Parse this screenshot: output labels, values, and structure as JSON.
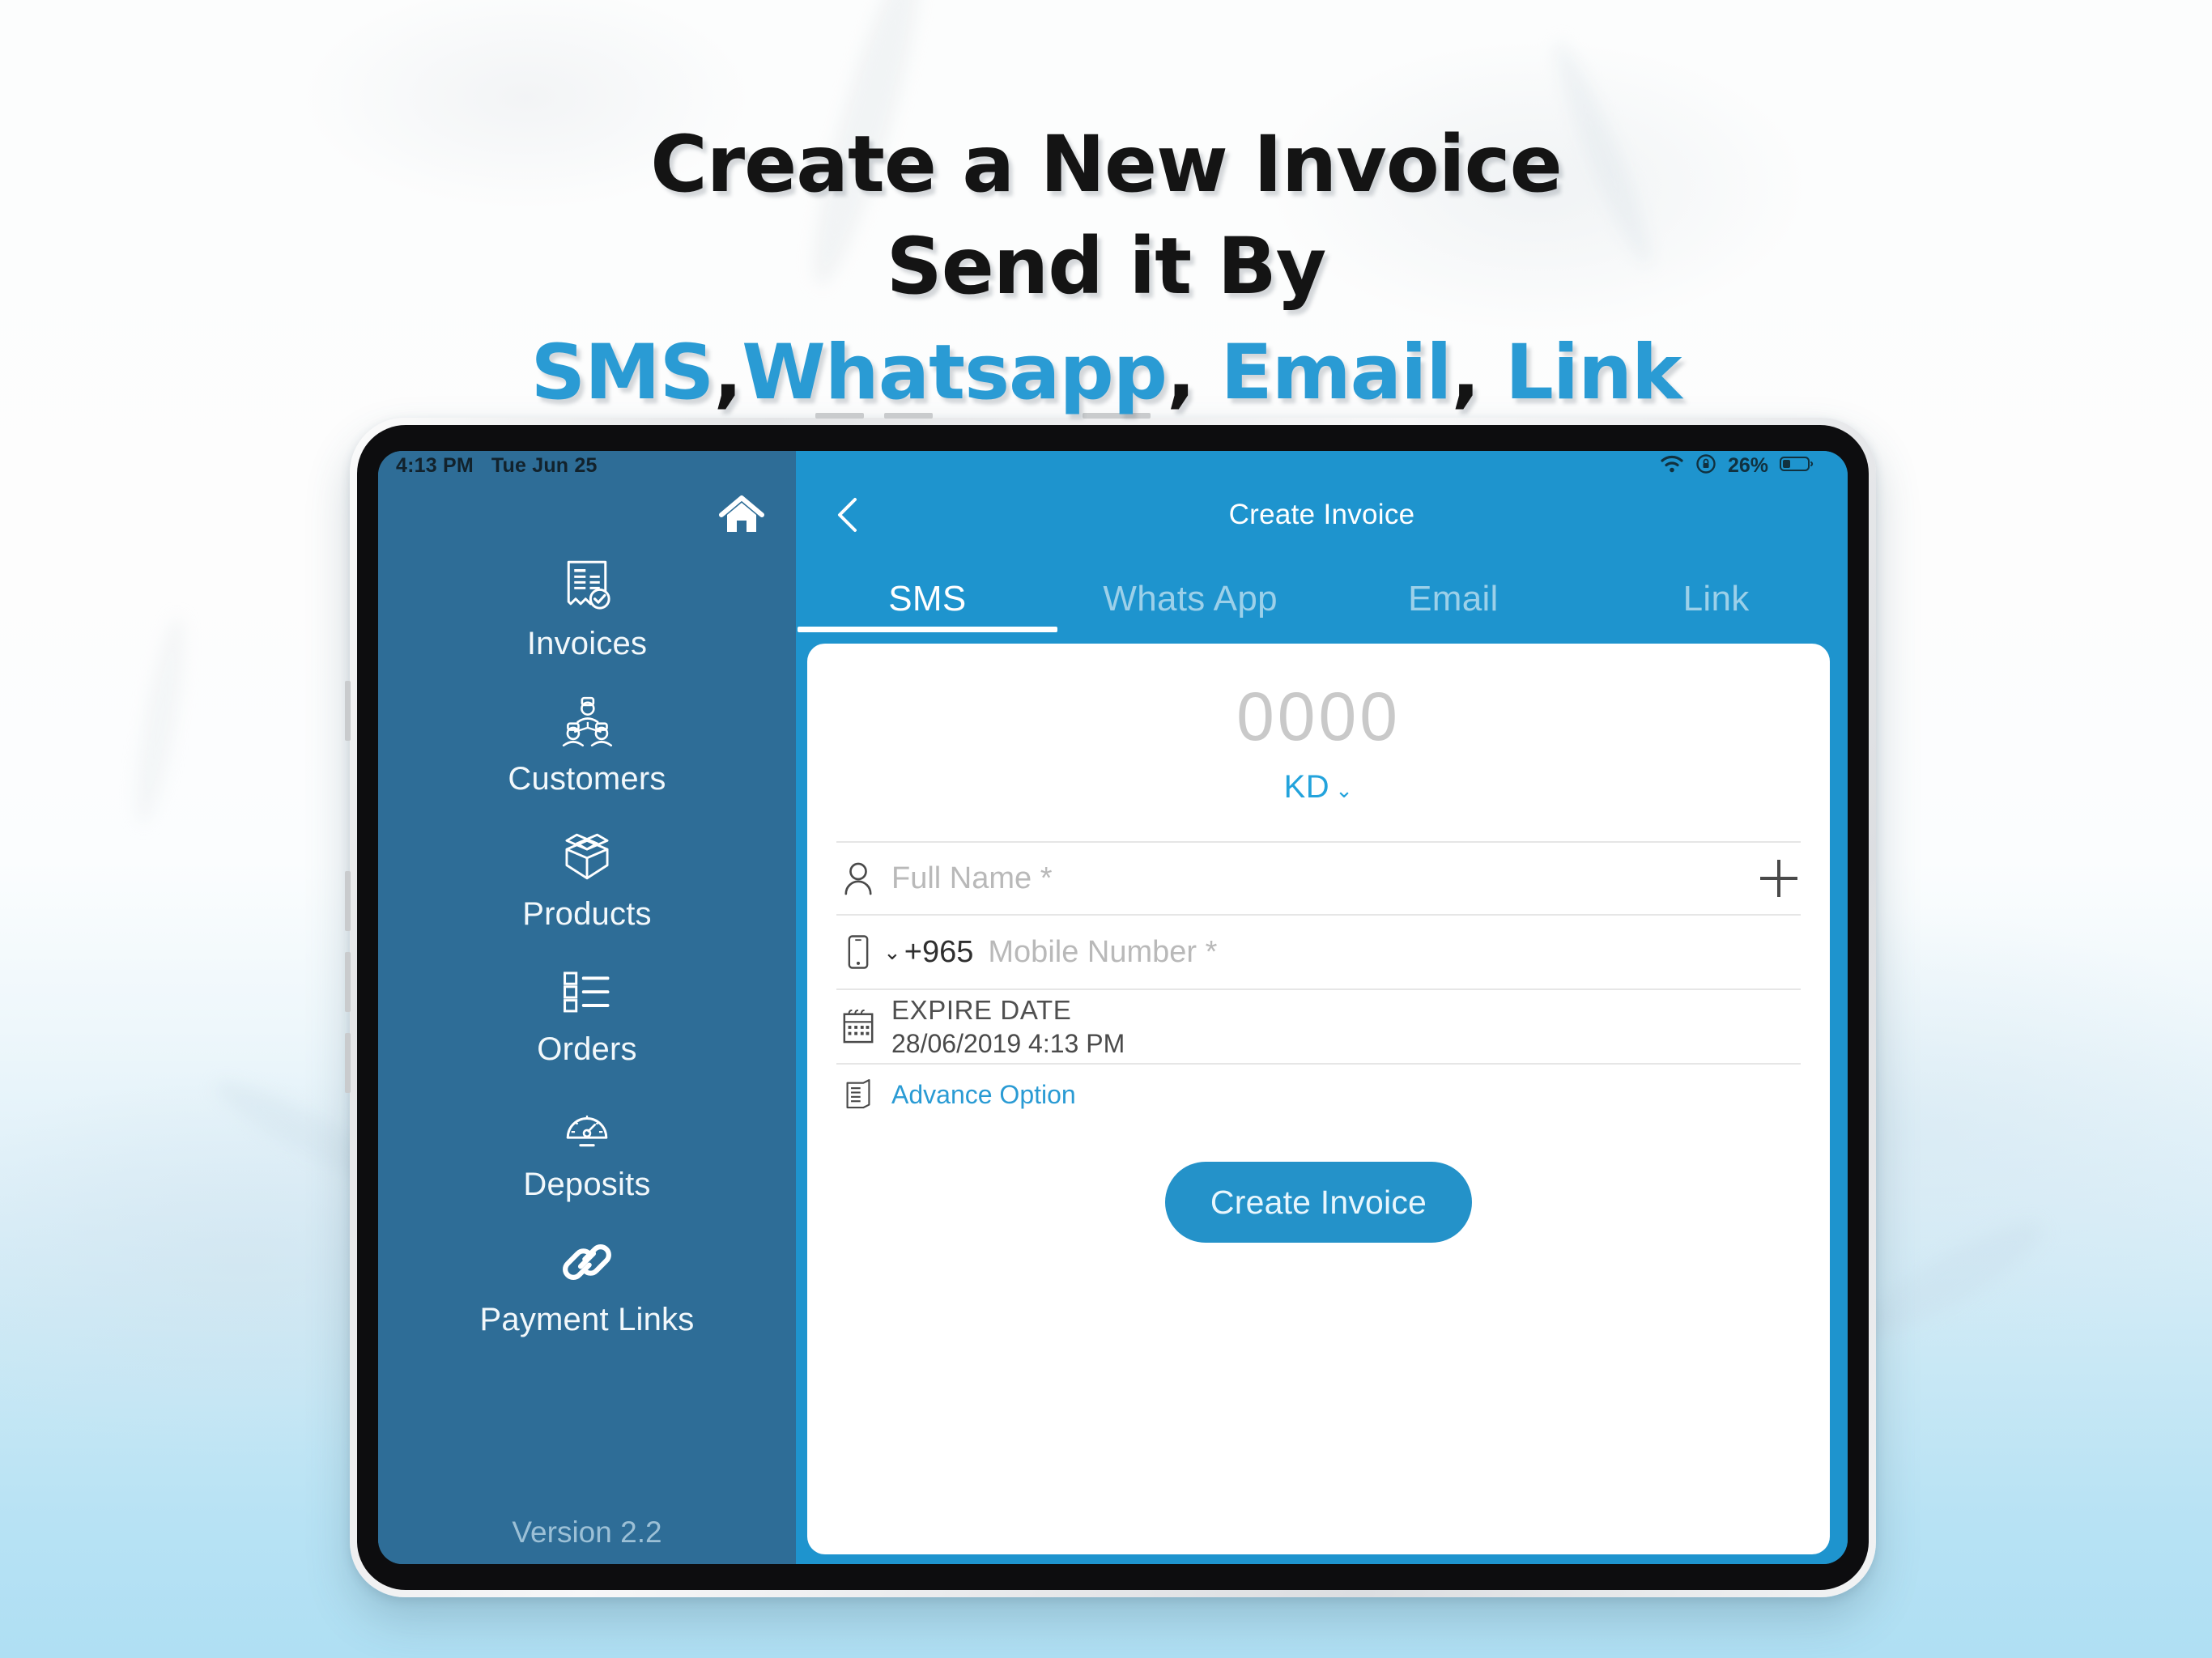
{
  "promo": {
    "line1": "Create a New Invoice",
    "line2": "Send it By",
    "channels": [
      "SMS",
      "Whatsapp",
      "Email",
      "Link"
    ],
    "separator": ",",
    "accent_color": "#2A9BD4",
    "text_color": "#141414"
  },
  "status_bar": {
    "time": "4:13 PM",
    "date": "Tue Jun 25",
    "battery_percent": "26%",
    "wifi_icon": "wifi-icon",
    "rotation_lock_icon": "rotation-lock-icon",
    "battery_icon": "battery-icon"
  },
  "sidebar": {
    "background_color": "#2E6D97",
    "home_icon": "home-icon",
    "items": [
      {
        "label": "Invoices",
        "icon": "invoice-document-icon"
      },
      {
        "label": "Customers",
        "icon": "people-group-icon"
      },
      {
        "label": "Products",
        "icon": "open-box-icon"
      },
      {
        "label": "Orders",
        "icon": "checklist-icon"
      },
      {
        "label": "Deposits",
        "icon": "gauge-icon"
      },
      {
        "label": "Payment Links",
        "icon": "chain-link-icon"
      }
    ],
    "version": "Version 2.2"
  },
  "main": {
    "accent_color": "#1E94CE",
    "back_icon": "chevron-left-icon",
    "title": "Create Invoice",
    "tabs": [
      {
        "label": "SMS",
        "active": true
      },
      {
        "label": "Whats App",
        "active": false
      },
      {
        "label": "Email",
        "active": false
      },
      {
        "label": "Link",
        "active": false
      }
    ],
    "form": {
      "amount_placeholder": "0000",
      "currency": "KD",
      "currency_caret": "⌄",
      "full_name_icon": "person-icon",
      "full_name_placeholder": "Full Name *",
      "add_contact_icon": "plus-icon",
      "phone_icon": "mobile-phone-icon",
      "country_caret": "⌄",
      "country_code": "+965",
      "mobile_placeholder": "Mobile Number *",
      "calendar_icon": "calendar-icon",
      "expire_date_label": "EXPIRE DATE",
      "expire_date_value": "28/06/2019 4:13 PM",
      "advance_icon": "document-list-icon",
      "advance_option_label": "Advance Option",
      "submit_label": "Create Invoice",
      "submit_color": "#2492C9"
    }
  }
}
